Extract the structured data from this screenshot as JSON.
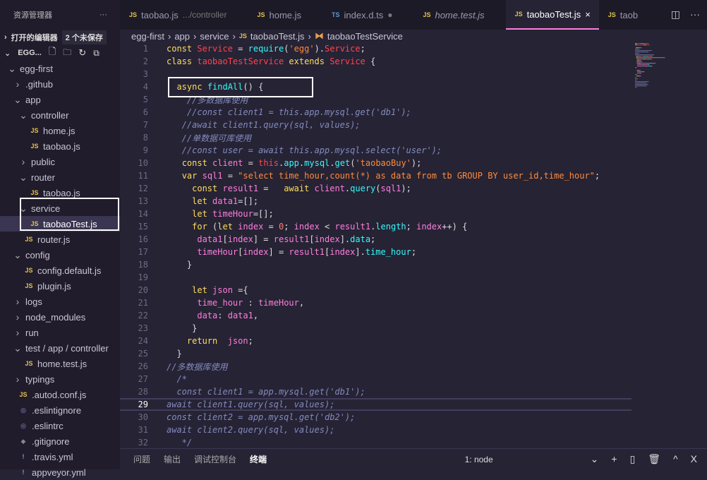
{
  "sidebar": {
    "title": "资源管理器",
    "more": "···",
    "open_editors": "打开的编辑器",
    "unsaved": "2 个未保存",
    "root": "EGG...",
    "tree": [
      {
        "label": "egg-first",
        "indent": 1,
        "chev": "v"
      },
      {
        "label": ".github",
        "indent": 2,
        "chev": ">"
      },
      {
        "label": "app",
        "indent": 2,
        "chev": "v"
      },
      {
        "label": "controller",
        "indent": 3,
        "chev": "v"
      },
      {
        "label": "home.js",
        "indent": 4,
        "icon": "JS"
      },
      {
        "label": "taobao.js",
        "indent": 4,
        "icon": "JS"
      },
      {
        "label": "public",
        "indent": 3,
        "chev": ">"
      },
      {
        "label": "router",
        "indent": 3,
        "chev": "v"
      },
      {
        "label": "taobao.js",
        "indent": 4,
        "icon": "JS"
      },
      {
        "label": "service",
        "indent": 3,
        "chev": "v"
      },
      {
        "label": "taobaoTest.js",
        "indent": 4,
        "icon": "JS",
        "selected": true
      },
      {
        "label": "router.js",
        "indent": 3,
        "icon": "JS"
      },
      {
        "label": "config",
        "indent": 2,
        "chev": "v"
      },
      {
        "label": "config.default.js",
        "indent": 3,
        "icon": "JS"
      },
      {
        "label": "plugin.js",
        "indent": 3,
        "icon": "JS"
      },
      {
        "label": "logs",
        "indent": 2,
        "chev": ">"
      },
      {
        "label": "node_modules",
        "indent": 2,
        "chev": ">"
      },
      {
        "label": "run",
        "indent": 2,
        "chev": ">"
      },
      {
        "label": "test / app / controller",
        "indent": 2,
        "chev": "v"
      },
      {
        "label": "home.test.js",
        "indent": 3,
        "icon": "JS"
      },
      {
        "label": "typings",
        "indent": 2,
        "chev": ">"
      },
      {
        "label": ".autod.conf.js",
        "indent": 2,
        "icon": "JS"
      },
      {
        "label": ".eslintignore",
        "indent": 2,
        "icon": "◎"
      },
      {
        "label": ".eslintrc",
        "indent": 2,
        "icon": "◎"
      },
      {
        "label": ".gitignore",
        "indent": 2,
        "icon": "◆"
      },
      {
        "label": ".travis.yml",
        "indent": 2,
        "icon": "!"
      },
      {
        "label": "appveyor.yml",
        "indent": 2,
        "icon": "!"
      }
    ]
  },
  "tabs": [
    {
      "label": "taobao.js",
      "hint": ".../controller",
      "type": "JS"
    },
    {
      "label": "home.js",
      "type": "JS"
    },
    {
      "label": "index.d.ts",
      "type": "TS",
      "dirty": "●"
    },
    {
      "label": "home.test.js",
      "type": "JS",
      "italic": true
    },
    {
      "label": "taobaoTest.js",
      "type": "JS",
      "active": true,
      "close": "×"
    },
    {
      "label": "taob",
      "type": "JS"
    }
  ],
  "breadcrumb": [
    "egg-first",
    "app",
    "service",
    "taobaoTest.js",
    "taobaoTestService"
  ],
  "current_line": 29,
  "code": [
    [
      [
        "k",
        "const "
      ],
      [
        "c",
        "Service"
      ],
      [
        "p",
        " = "
      ],
      [
        "f",
        "require"
      ],
      [
        "p",
        "("
      ],
      [
        "s",
        "'egg'"
      ],
      [
        "p",
        ")."
      ],
      [
        "c",
        "Service"
      ],
      [
        "p",
        ";"
      ]
    ],
    [
      [
        "k",
        "class "
      ],
      [
        "c",
        "taobaoTestService "
      ],
      [
        "k",
        "extends "
      ],
      [
        "c",
        "Service "
      ],
      [
        "p",
        "{"
      ]
    ],
    [],
    [
      [
        "p",
        "  "
      ],
      [
        "k",
        "async "
      ],
      [
        "f",
        "findAll"
      ],
      [
        "p",
        "() {"
      ]
    ],
    [
      [
        "cm",
        "    //多数据库使用"
      ]
    ],
    [
      [
        "cm",
        "    //const client1 = this.app.mysql.get('db1');"
      ]
    ],
    [
      [
        "cm",
        "   //await client1.query(sql, values);"
      ]
    ],
    [
      [
        "cm",
        "   //单数据可库使用"
      ]
    ],
    [
      [
        "cm",
        "   //const user = await this.app.mysql.select('user');"
      ]
    ],
    [
      [
        "p",
        "   "
      ],
      [
        "k",
        "const "
      ],
      [
        "v",
        "client"
      ],
      [
        "p",
        " = "
      ],
      [
        "c",
        "this"
      ],
      [
        "p",
        "."
      ],
      [
        "f",
        "app"
      ],
      [
        "p",
        "."
      ],
      [
        "f",
        "mysql"
      ],
      [
        "p",
        "."
      ],
      [
        "f",
        "get"
      ],
      [
        "p",
        "("
      ],
      [
        "s",
        "'taobaoBuy'"
      ],
      [
        "p",
        ");"
      ]
    ],
    [
      [
        "p",
        "   "
      ],
      [
        "k",
        "var "
      ],
      [
        "v",
        "sql1"
      ],
      [
        "p",
        " = "
      ],
      [
        "s",
        "\"select time_hour,count(*) as data from tb GROUP BY user_id,time_hour\""
      ],
      [
        "p",
        ";"
      ]
    ],
    [
      [
        "p",
        "     "
      ],
      [
        "k",
        "const "
      ],
      [
        "v",
        "result1"
      ],
      [
        "p",
        " =   "
      ],
      [
        "k",
        "await "
      ],
      [
        "v",
        "client"
      ],
      [
        "p",
        "."
      ],
      [
        "f",
        "query"
      ],
      [
        "p",
        "("
      ],
      [
        "v",
        "sql1"
      ],
      [
        "p",
        ");"
      ]
    ],
    [
      [
        "p",
        "     "
      ],
      [
        "k",
        "let "
      ],
      [
        "v",
        "data1"
      ],
      [
        "p",
        "=[];"
      ]
    ],
    [
      [
        "p",
        "     "
      ],
      [
        "k",
        "let "
      ],
      [
        "v",
        "timeHour"
      ],
      [
        "p",
        "=[];"
      ]
    ],
    [
      [
        "p",
        "     "
      ],
      [
        "k",
        "for "
      ],
      [
        "p",
        "("
      ],
      [
        "k",
        "let "
      ],
      [
        "v",
        "index"
      ],
      [
        "p",
        " = "
      ],
      [
        "n",
        "0"
      ],
      [
        "p",
        "; "
      ],
      [
        "v",
        "index"
      ],
      [
        "p",
        " < "
      ],
      [
        "v",
        "result1"
      ],
      [
        "p",
        "."
      ],
      [
        "f",
        "length"
      ],
      [
        "p",
        "; "
      ],
      [
        "v",
        "index"
      ],
      [
        "p",
        "++) {"
      ]
    ],
    [
      [
        "p",
        "      "
      ],
      [
        "v",
        "data1"
      ],
      [
        "p",
        "["
      ],
      [
        "v",
        "index"
      ],
      [
        "p",
        "] = "
      ],
      [
        "v",
        "result1"
      ],
      [
        "p",
        "["
      ],
      [
        "v",
        "index"
      ],
      [
        "p",
        "]."
      ],
      [
        "f",
        "data"
      ],
      [
        "p",
        ";"
      ]
    ],
    [
      [
        "p",
        "      "
      ],
      [
        "v",
        "timeHour"
      ],
      [
        "p",
        "["
      ],
      [
        "v",
        "index"
      ],
      [
        "p",
        "] = "
      ],
      [
        "v",
        "result1"
      ],
      [
        "p",
        "["
      ],
      [
        "v",
        "index"
      ],
      [
        "p",
        "]."
      ],
      [
        "f",
        "time_hour"
      ],
      [
        "p",
        ";"
      ]
    ],
    [
      [
        "p",
        "    }"
      ]
    ],
    [],
    [
      [
        "p",
        "     "
      ],
      [
        "k",
        "let "
      ],
      [
        "v",
        "json"
      ],
      [
        "p",
        " ={"
      ]
    ],
    [
      [
        "p",
        "      "
      ],
      [
        "v",
        "time_hour"
      ],
      [
        "p",
        " : "
      ],
      [
        "v",
        "timeHour"
      ],
      [
        "p",
        ","
      ]
    ],
    [
      [
        "p",
        "      "
      ],
      [
        "v",
        "data"
      ],
      [
        "p",
        ": "
      ],
      [
        "v",
        "data1"
      ],
      [
        "p",
        ","
      ]
    ],
    [
      [
        "p",
        "     }"
      ]
    ],
    [
      [
        "p",
        "    "
      ],
      [
        "k",
        "return  "
      ],
      [
        "v",
        "json"
      ],
      [
        "p",
        ";"
      ]
    ],
    [
      [
        "p",
        "  }"
      ]
    ],
    [
      [
        "cm",
        "//多数据库使用"
      ]
    ],
    [
      [
        "cm",
        "  /*"
      ]
    ],
    [
      [
        "cm",
        "  const client1 = app.mysql.get('db1');"
      ]
    ],
    [
      [
        "cm",
        "await client1.query(sql, values);"
      ]
    ],
    [
      [
        "cm",
        "const client2 = app.mysql.get('db2');"
      ]
    ],
    [
      [
        "cm",
        "await client2.query(sql, values);"
      ]
    ],
    [
      [
        "cm",
        "   */"
      ]
    ]
  ],
  "panel": {
    "tabs": [
      "问题",
      "输出",
      "调试控制台",
      "终端"
    ],
    "active": 3,
    "terminal": "1: node",
    "icons": [
      "chevron-down",
      "plus",
      "split",
      "trash",
      "chevron-up",
      "close"
    ],
    "glyphs": [
      "⌄",
      "+",
      "▯",
      "🗑",
      "^",
      "X"
    ]
  },
  "tab_actions": {
    "split": "◫",
    "more": "···"
  }
}
